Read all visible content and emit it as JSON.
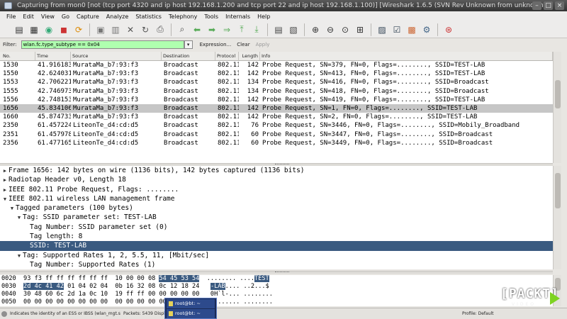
{
  "window": {
    "title": "Capturing from mon0   [not (tcp port 4320 and ip host 192.168.1.200 and tcp port 22 and ip host 192.168.1.100)]   [Wireshark 1.6.5  (SVN Rev Unknown from unknown)]"
  },
  "menu": [
    "File",
    "Edit",
    "View",
    "Go",
    "Capture",
    "Analyze",
    "Statistics",
    "Telephony",
    "Tools",
    "Internals",
    "Help"
  ],
  "toolbar": {
    "icons": [
      "interface-list-icon",
      "capture-options-icon",
      "start-capture-icon",
      "stop-capture-icon",
      "restart-capture-icon",
      "open-file-icon",
      "save-file-icon",
      "close-file-icon",
      "reload-icon",
      "print-icon",
      "find-packet-icon",
      "go-back-icon",
      "go-forward-icon",
      "go-to-packet-icon",
      "go-first-icon",
      "go-last-icon",
      "colorize-icon",
      "autoscroll-icon",
      "zoom-in-icon",
      "zoom-out-icon",
      "normal-size-icon",
      "resize-columns-icon",
      "capture-filters-icon",
      "display-filters-icon",
      "coloring-rules-icon",
      "preferences-icon",
      "help-icon"
    ]
  },
  "filter": {
    "label": "Filter:",
    "value": "wlan.fc.type_subtype == 0x04",
    "expression": "Expression...",
    "clear": "Clear",
    "apply": "Apply"
  },
  "packet_list": {
    "columns": [
      "No.",
      "Time",
      "Source",
      "Destination",
      "Protocol",
      "Length",
      "Info"
    ],
    "rows": [
      {
        "no": "1530",
        "time": "41.916183",
        "src": "MurataMa_b7:93:f3",
        "dst": "Broadcast",
        "proto": "802.11",
        "len": "142",
        "info": "Probe Request, SN=379, FN=0, Flags=........, SSID=TEST-LAB"
      },
      {
        "no": "1550",
        "time": "42.624031",
        "src": "MurataMa_b7:93:f3",
        "dst": "Broadcast",
        "proto": "802.11",
        "len": "142",
        "info": "Probe Request, SN=413, FN=0, Flags=........, SSID=TEST-LAB"
      },
      {
        "no": "1553",
        "time": "42.706221",
        "src": "MurataMa_b7:93:f3",
        "dst": "Broadcast",
        "proto": "802.11",
        "len": "134",
        "info": "Probe Request, SN=416, FN=0, Flags=........, SSID=Broadcast"
      },
      {
        "no": "1555",
        "time": "42.746973",
        "src": "MurataMa_b7:93:f3",
        "dst": "Broadcast",
        "proto": "802.11",
        "len": "134",
        "info": "Probe Request, SN=418, FN=0, Flags=........, SSID=Broadcast"
      },
      {
        "no": "1556",
        "time": "42.748153",
        "src": "MurataMa_b7:93:f3",
        "dst": "Broadcast",
        "proto": "802.11",
        "len": "142",
        "info": "Probe Request, SN=419, FN=0, Flags=........, SSID=TEST-LAB"
      },
      {
        "no": "1656",
        "time": "45.834106",
        "src": "MurataMa_b7:93:f3",
        "dst": "Broadcast",
        "proto": "802.11",
        "len": "142",
        "info": "Probe Request, SN=1, FN=0, Flags=........, SSID=TEST-LAB"
      },
      {
        "no": "1660",
        "time": "45.874733",
        "src": "MurataMa_b7:93:f3",
        "dst": "Broadcast",
        "proto": "802.11",
        "len": "142",
        "info": "Probe Request, SN=2, FN=0, Flags=........, SSID=TEST-LAB"
      },
      {
        "no": "2350",
        "time": "61.457224",
        "src": "LiteonTe_d4:cd:d5",
        "dst": "Broadcast",
        "proto": "802.11",
        "len": "76",
        "info": "Probe Request, SN=3446, FN=0, Flags=........, SSID=Mobily_Broadband"
      },
      {
        "no": "2351",
        "time": "61.457978",
        "src": "LiteonTe_d4:cd:d5",
        "dst": "Broadcast",
        "proto": "802.11",
        "len": "60",
        "info": "Probe Request, SN=3447, FN=0, Flags=........, SSID=Broadcast"
      },
      {
        "no": "2356",
        "time": "61.477165",
        "src": "LiteonTe_d4:cd:d5",
        "dst": "Broadcast",
        "proto": "802.11",
        "len": "60",
        "info": "Probe Request, SN=3449, FN=0, Flags=........, SSID=Broadcast"
      }
    ],
    "selected_index": 5
  },
  "details": [
    {
      "indent": 0,
      "toggle": "closed",
      "text": "Frame 1656: 142 bytes on wire (1136 bits), 142 bytes captured (1136 bits)"
    },
    {
      "indent": 0,
      "toggle": "closed",
      "text": "Radiotap Header v0, Length 18"
    },
    {
      "indent": 0,
      "toggle": "closed",
      "text": "IEEE 802.11 Probe Request, Flags: ........"
    },
    {
      "indent": 0,
      "toggle": "open",
      "text": "IEEE 802.11 wireless LAN management frame"
    },
    {
      "indent": 1,
      "toggle": "open",
      "text": "Tagged parameters (100 bytes)"
    },
    {
      "indent": 2,
      "toggle": "open",
      "text": "Tag: SSID parameter set: TEST-LAB"
    },
    {
      "indent": 3,
      "toggle": "none",
      "text": "Tag Number: SSID parameter set (0)"
    },
    {
      "indent": 3,
      "toggle": "none",
      "text": "Tag length: 8"
    },
    {
      "indent": 3,
      "toggle": "none",
      "text": "SSID: TEST-LAB",
      "selected": true
    },
    {
      "indent": 2,
      "toggle": "open",
      "text": "Tag: Supported Rates 1, 2, 5.5, 11, [Mbit/sec]"
    },
    {
      "indent": 3,
      "toggle": "none",
      "text": "Tag Number: Supported Rates (1)"
    }
  ],
  "bytes": [
    {
      "pre": "0020  93 f3 ff ff ff ff ff ff  10 00 00 08 ",
      "hl": "54 45 53 54",
      "mid": "  ........ ....",
      "hl2": "TEST",
      "post": ""
    },
    {
      "pre": "0030  ",
      "hl": "2d 4c 41 42",
      "mid": " 01 04 02 04  0b 16 32 08 0c 12 18 24   ",
      "hl2": "-LAB",
      "post": ".... ..2...$"
    },
    {
      "pre": "0040  30 48 60 6c 2d 1a 0c 10  19 ff ff 00 00 00 00 00   0H`l-... ........",
      "hl": "",
      "mid": "",
      "hl2": "",
      "post": ""
    },
    {
      "pre": "0050  00 00 00 00 00 00 00 00  00 00 00 00 00 00 00 00   ........ ........",
      "hl": "",
      "mid": "",
      "hl2": "",
      "post": ""
    }
  ],
  "status": {
    "left": "Indicates the identity of an ESS or IBSS (wlan_mgt.ssid), 8 bytes",
    "packets": "Packets: 5439 Displayed: 30 Marked: 0",
    "profile": "Profile: Default"
  },
  "taskbar": {
    "items": [
      "root@bt: ~",
      "root@bt: ~"
    ]
  },
  "watermark": {
    "word": "[PACKT]",
    "sub": "VIDEO"
  }
}
